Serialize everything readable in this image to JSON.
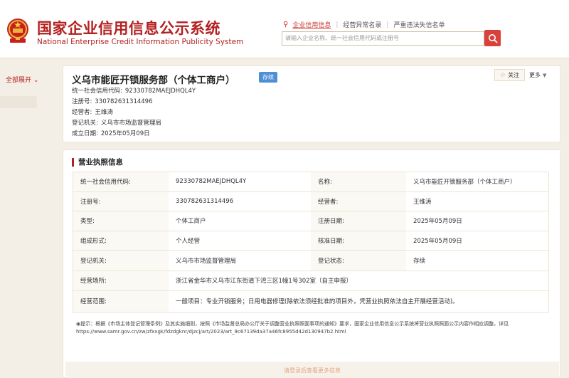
{
  "header": {
    "title_cn": "国家企业信用信息公示系统",
    "title_en": "National Enterprise Credit Information Publicity System",
    "nav": [
      "企业信用信息",
      "经营异常名录",
      "严重违法失信名单"
    ],
    "search_placeholder": "请输入企业名称、统一社会信用代码或注册号",
    "icons": {
      "emblem": "national-emblem-icon",
      "search": "search-icon",
      "magnifier": "magnifier-icon"
    }
  },
  "sidebar": {
    "expand_all": "全部展开 ⌄"
  },
  "company": {
    "name": "义乌市能匠开锁服务部（个体工商户）",
    "status": "存续",
    "follow": "关注",
    "more": "更多",
    "fields": [
      {
        "label": "统一社会信用代码:",
        "value": "92330782MAEJDHQL4Y"
      },
      {
        "label": "注册号:",
        "value": "330782631314496"
      },
      {
        "label": "经营者:",
        "value": "王维涛"
      },
      {
        "label": "登记机关:",
        "value": "义乌市市场监督管理局"
      },
      {
        "label": "成立日期:",
        "value": "2025年05月09日"
      }
    ]
  },
  "license": {
    "title": "营业执照信息",
    "rows": [
      [
        "统一社会信用代码:",
        "92330782MAEJDHQL4Y",
        "名称:",
        "义乌市能匠开锁服务部（个体工商户）"
      ],
      [
        "注册号:",
        "330782631314496",
        "经营者:",
        "王维涛"
      ],
      [
        "类型:",
        "个体工商户",
        "注册日期:",
        "2025年05月09日"
      ],
      [
        "组成形式:",
        "个人经营",
        "核准日期:",
        "2025年05月09日"
      ],
      [
        "登记机关:",
        "义乌市市场监督管理局",
        "登记状态:",
        "存续"
      ]
    ],
    "address_label": "经营场所:",
    "address_value": "浙江省金华市义乌市江东街道下湾三区1幢1号302室（自主申报）",
    "scope_label": "经营范围:",
    "scope_value": "一般项目：专业开锁服务；日用电器修理(除依法须经批准的项目外，凭营业执照依法自主开展经营活动)。"
  },
  "notice": {
    "icon": "info-icon",
    "text": "提示：根据《市场主体登记管理条例》及其实施细则，按照《市场监督总局办公厅关于调整营业执照照面事项的通知》要求，国家企业信用信息公示系统将营业执照照面公示内容作相应调整，详见https://www.samr.gov.cn/zw/zfxxgk/fdzdgknr/djzcj/art/2023/art_9c67139da37a46fc8955d42d130947b2.html"
  },
  "login_prompt": "请登录后查看更多信息",
  "colors": {
    "brand_red": "#b3201f",
    "badge_blue": "#4e8fd6",
    "search_red": "#d8423a",
    "background": "#f3efe6"
  }
}
